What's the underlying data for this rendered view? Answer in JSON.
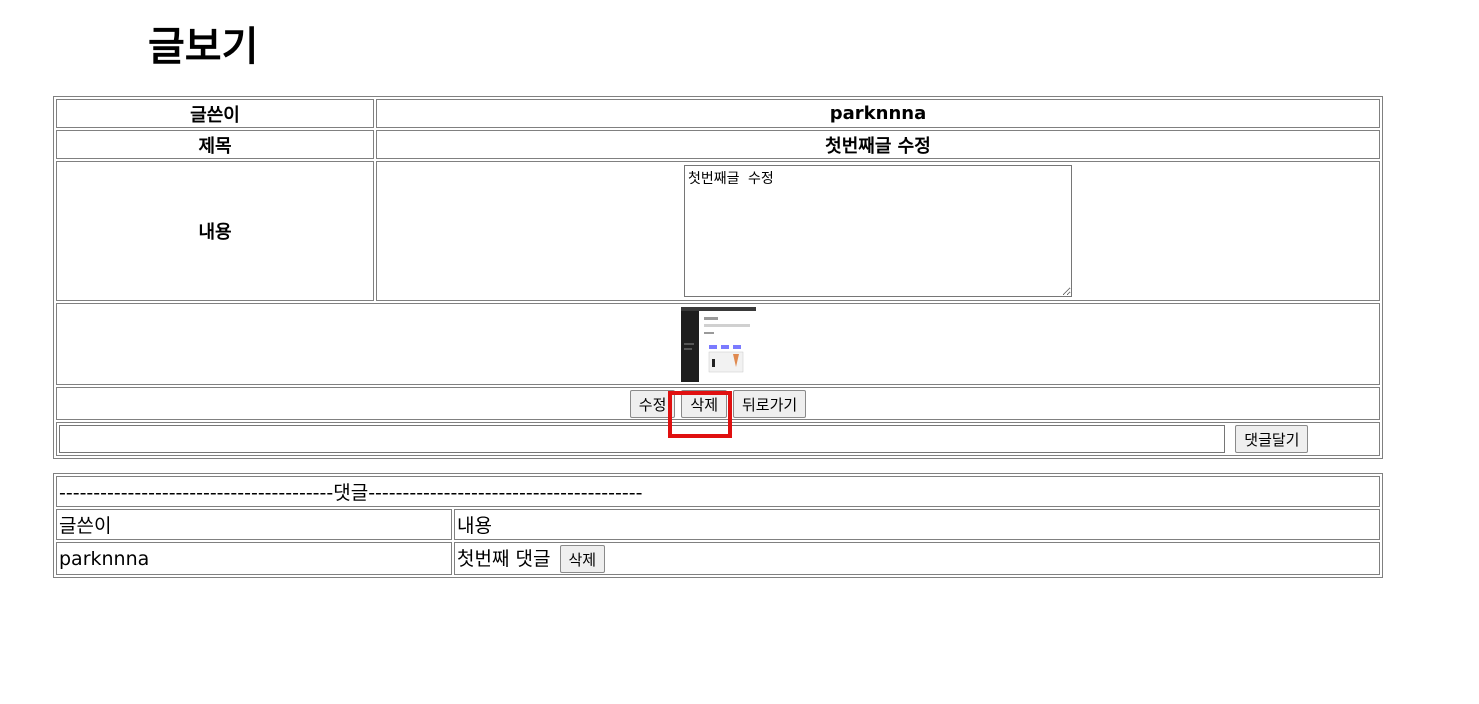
{
  "page": {
    "title": "글보기"
  },
  "post": {
    "author_label": "글쓴이",
    "author_value": "parknnna",
    "title_label": "제목",
    "title_value": "첫번째글 수정",
    "content_label": "내용",
    "content_value": "첫번째글 수정"
  },
  "actions": {
    "edit_label": "수정",
    "delete_label": "삭제",
    "back_label": "뒤로가기"
  },
  "comment_form": {
    "input_value": "",
    "submit_label": "댓글달기"
  },
  "comments": {
    "divider_text": "----------------------------------------댓글----------------------------------------",
    "header_author": "글쓴이",
    "header_content": "내용",
    "rows": [
      {
        "author": "parknnna",
        "content": "첫번째 댓글",
        "delete_label": "삭제"
      }
    ]
  },
  "colors": {
    "highlight": "#e01010",
    "border": "#808080"
  }
}
